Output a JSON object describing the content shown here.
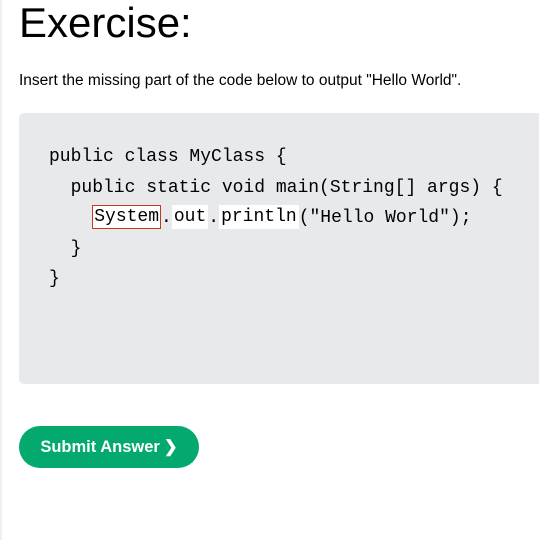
{
  "exercise": {
    "title": "Exercise:",
    "instruction": "Insert the missing part of the code below to output \"Hello World\".",
    "code": {
      "line1": "public class MyClass {",
      "line2": "  public static void main(String[] args) {",
      "line3_indent": "    ",
      "blank1_value": "System",
      "dot1": ".",
      "blank2_value": "out",
      "dot2": ".",
      "blank3_value": "println",
      "line3_rest": "(\"Hello World\");",
      "line4": "  }",
      "line5": "}"
    },
    "submit_label": "Submit Answer",
    "submit_icon": "❯"
  },
  "colors": {
    "code_background": "#e7e9eb",
    "active_blank_border": "#c7381b",
    "submit_background": "#04aa6d",
    "submit_text": "#ffffff"
  }
}
